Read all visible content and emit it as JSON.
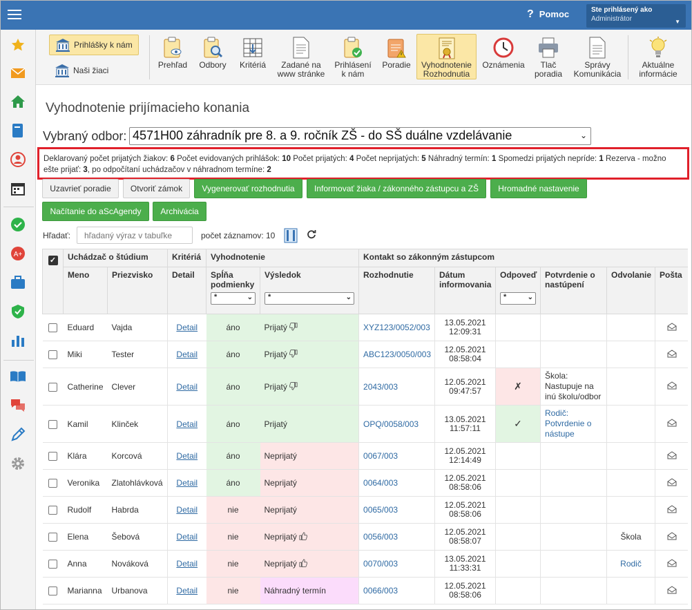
{
  "header": {
    "help_label": "Pomoc",
    "user_caption": "Ste prihlásený ako",
    "user_name": "Administrátor"
  },
  "colors": {
    "header_bg": "#3a74b4",
    "accent_green": "#4cae4c",
    "highlight_red": "#e0202a"
  },
  "left_buttons": [
    {
      "label": "Prihlášky k nám",
      "icon": "building-icon",
      "active": true
    },
    {
      "label": "Naši žiaci",
      "icon": "building-icon",
      "active": false
    }
  ],
  "toolbar": [
    {
      "label": "Prehľad",
      "icon": "clipboard-eye-icon"
    },
    {
      "label": "Odbory",
      "icon": "clipboard-search-icon"
    },
    {
      "label": "Kritériá",
      "icon": "grid-import-icon"
    },
    {
      "label": "Zadané na www stránke",
      "icon": "document-icon"
    },
    {
      "label": "Prihlásení k nám",
      "icon": "clipboard-check-icon"
    },
    {
      "label": "Poradie",
      "icon": "clipboard-warning-icon"
    },
    {
      "label": "Vyhodnotenie Rozhodnutia",
      "icon": "certificate-icon",
      "active": true
    },
    {
      "label": "Oznámenia",
      "icon": "clock-icon"
    },
    {
      "label": "Tlač poradia",
      "icon": "printer-icon"
    },
    {
      "label": "Správy Komunikácia",
      "icon": "report-icon"
    },
    {
      "label": "Aktuálne informácie",
      "icon": "lightbulb-icon"
    }
  ],
  "page": {
    "title": "Vyhodnotenie prijímacieho konania",
    "odbor_label": "Vybraný odbor:",
    "odbor_value": "4571H00 záhradník pre 8. a 9. ročník ZŠ - do SŠ duálne vzdelávanie"
  },
  "summary": {
    "declared_label": "Deklarovaný počet prijatých žiakov:",
    "declared": "6",
    "registered_label": "Počet evidovaných prihlášok:",
    "registered": "10",
    "accepted_label": "Počet prijatých:",
    "accepted": "4",
    "rejected_label": "Počet neprijatých:",
    "rejected": "5",
    "alternate_label": "Náhradný termín:",
    "alternate": "1",
    "noshow_label": "Spomedzi prijatých nepríde:",
    "noshow": "1",
    "reserve_label": "Rezerva - možno ešte prijať:",
    "reserve": "3",
    "after_label": ", po odpočítaní uchádzačov v náhradnom termíne:",
    "after": "2"
  },
  "actions": {
    "close_order": "Uzavrieť poradie",
    "open_lock": "Otvoriť zámok",
    "generate": "Vygenerovať rozhodnutia",
    "inform": "Informovať žiaka / zákonného zástupcu a ZŠ",
    "bulk": "Hromadné nastavenie",
    "load": "Načítanie do aScAgendy",
    "archive": "Archivácia"
  },
  "search": {
    "label": "Hľadať:",
    "placeholder": "hľadaný výraz v tabuľke",
    "count_label": "počet záznamov:",
    "count": "10"
  },
  "table": {
    "group_applicant": "Uchádzač o štúdium",
    "group_criteria": "Kritériá",
    "group_eval": "Vyhodnotenie",
    "group_contact": "Kontakt so zákonným zástupcom",
    "col_first": "Meno",
    "col_last": "Priezvisko",
    "col_detail": "Detail",
    "col_fulfils": "Spĺňa podmienky",
    "col_result": "Výsledok",
    "col_decision": "Rozhodnutie",
    "col_date": "Dátum informovania",
    "col_answer": "Odpoveď",
    "col_confirm": "Potvrdenie o nastúpení",
    "col_appeal": "Odvolanie",
    "col_mail": "Pošta",
    "filter_value": "*",
    "detail_link": "Detail",
    "rows": [
      {
        "first": "Eduard",
        "last": "Vajda",
        "fulfils": "áno",
        "result": "Prijatý",
        "thumb": "down",
        "decision": "XYZ123/0052/003",
        "date": "13.05.2021",
        "time": "12:09:31",
        "answer": "",
        "confirm": "",
        "appeal": ""
      },
      {
        "first": "Miki",
        "last": "Tester",
        "fulfils": "áno",
        "result": "Prijatý",
        "thumb": "down",
        "decision": "ABC123/0050/003",
        "date": "12.05.2021",
        "time": "08:58:04",
        "answer": "",
        "confirm": "",
        "appeal": ""
      },
      {
        "first": "Catherine",
        "last": "Clever",
        "fulfils": "áno",
        "result": "Prijatý",
        "thumb": "down",
        "decision": "2043/003",
        "date": "12.05.2021",
        "time": "09:47:57",
        "answer": "✗",
        "confirm": "Škola: Nastupuje na inú školu/odbor",
        "appeal": ""
      },
      {
        "first": "Kamil",
        "last": "Klinček",
        "fulfils": "áno",
        "result": "Prijatý",
        "thumb": "",
        "decision": "OPQ/0058/003",
        "date": "13.05.2021",
        "time": "11:57:11",
        "answer": "✓",
        "confirm": "Rodič: Potvrdenie o nástupe",
        "appeal": ""
      },
      {
        "first": "Klára",
        "last": "Korcová",
        "fulfils": "áno",
        "result": "Neprijatý",
        "thumb": "",
        "decision": "0067/003",
        "date": "12.05.2021",
        "time": "12:14:49",
        "answer": "",
        "confirm": "",
        "appeal": ""
      },
      {
        "first": "Veronika",
        "last": "Zlatohlávková",
        "fulfils": "áno",
        "result": "Neprijatý",
        "thumb": "",
        "decision": "0064/003",
        "date": "12.05.2021",
        "time": "08:58:06",
        "answer": "",
        "confirm": "",
        "appeal": ""
      },
      {
        "first": "Rudolf",
        "last": "Habrda",
        "fulfils": "nie",
        "result": "Neprijatý",
        "thumb": "",
        "decision": "0065/003",
        "date": "12.05.2021",
        "time": "08:58:06",
        "answer": "",
        "confirm": "",
        "appeal": ""
      },
      {
        "first": "Elena",
        "last": "Šebová",
        "fulfils": "nie",
        "result": "Neprijatý",
        "thumb": "up",
        "decision": "0056/003",
        "date": "12.05.2021",
        "time": "08:58:07",
        "answer": "",
        "confirm": "",
        "appeal": "Škola"
      },
      {
        "first": "Anna",
        "last": "Nováková",
        "fulfils": "nie",
        "result": "Neprijatý",
        "thumb": "up",
        "decision": "0070/003",
        "date": "13.05.2021",
        "time": "11:33:31",
        "answer": "",
        "confirm": "",
        "appeal": "Rodič"
      },
      {
        "first": "Marianna",
        "last": "Urbanova",
        "fulfils": "nie",
        "result": "Náhradný termín",
        "thumb": "",
        "decision": "0066/003",
        "date": "12.05.2021",
        "time": "08:58:06",
        "answer": "",
        "confirm": "",
        "appeal": ""
      }
    ]
  }
}
